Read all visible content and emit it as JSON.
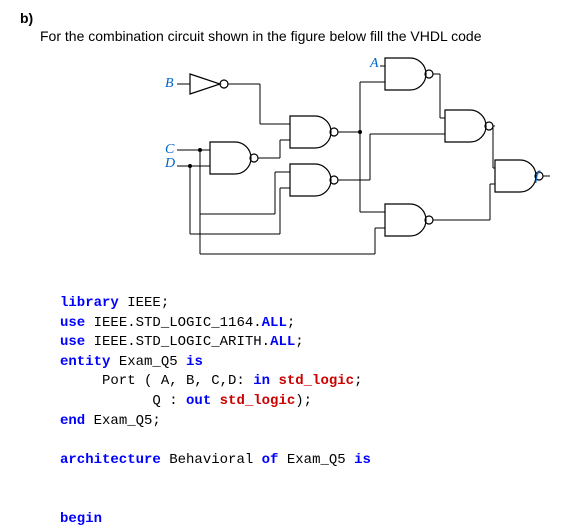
{
  "question": {
    "label": "b)",
    "text": "For the combination circuit shown in the figure below fill the VHDL code"
  },
  "circuit": {
    "inputs": {
      "A": "A",
      "B": "B",
      "C": "C",
      "D": "D"
    },
    "output": "f"
  },
  "code": {
    "l1_kw": "library",
    "l1_id": " IEEE;",
    "l2_kw1": "use",
    "l2_id": " IEEE.STD_LOGIC_1164.",
    "l2_kw2": "ALL",
    "l2_end": ";",
    "l3_kw1": "use",
    "l3_id": " IEEE.STD_LOGIC_ARITH.",
    "l3_kw2": "ALL",
    "l3_end": ";",
    "l4_kw1": "entity",
    "l4_id": " Exam_Q5 ",
    "l4_kw2": "is",
    "l5_pre": "     Port ( A, B, C,D: ",
    "l5_kw": "in",
    "l5_type": " std_logic",
    "l5_end": ";",
    "l6_pre": "           Q : ",
    "l6_kw": "out",
    "l6_type": " std_logic",
    "l6_end": ");",
    "l7_kw": "end",
    "l7_id": " Exam_Q5;",
    "l8_kw1": "architecture",
    "l8_id1": " Behavioral ",
    "l8_kw2": "of",
    "l8_id2": " Exam_Q5 ",
    "l8_kw3": "is",
    "l9_kw": "begin"
  }
}
